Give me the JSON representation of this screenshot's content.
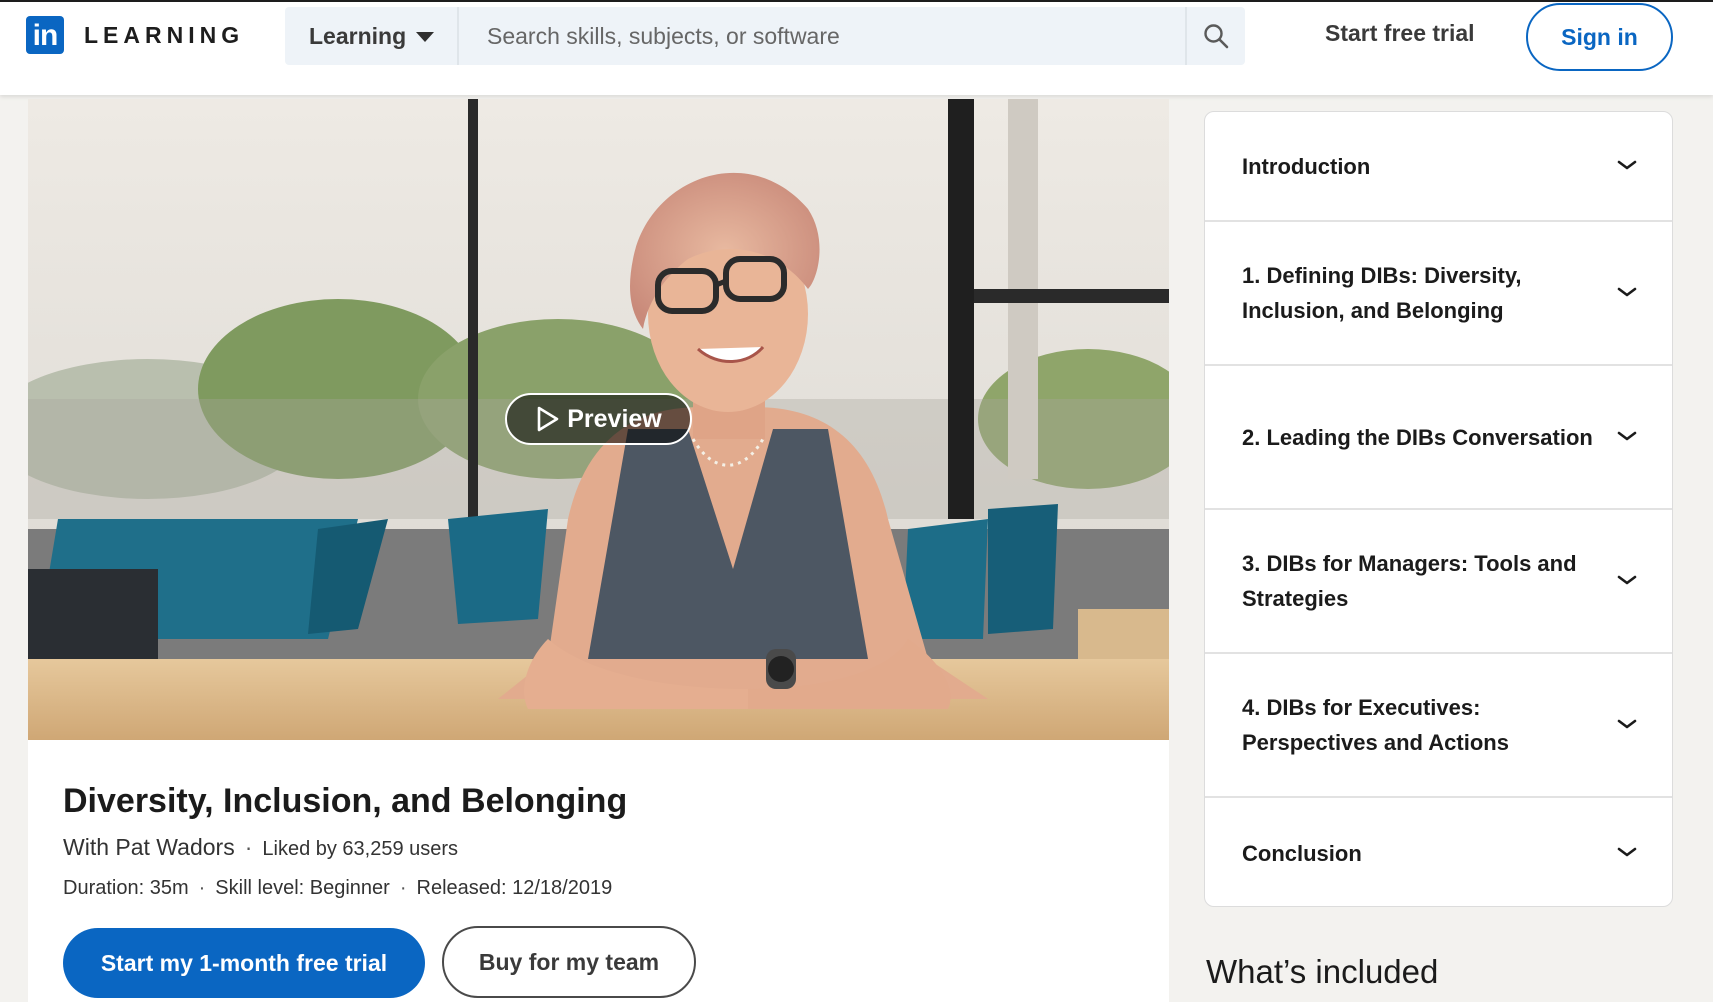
{
  "brand": {
    "logo_mark": "in",
    "logo_text": "LEARNING",
    "accent": "#0a66c2"
  },
  "header": {
    "category_label": "Learning",
    "search_placeholder": "Search skills, subjects, or software",
    "search_icon": "search-icon",
    "start_trial_label": "Start free trial",
    "sign_in_label": "Sign in"
  },
  "hero": {
    "preview_label": "Preview"
  },
  "course": {
    "title": "Diversity, Inclusion, and Belonging",
    "instructor": "With Pat Wadors",
    "likes": "Liked by 63,259 users",
    "duration": "Duration: 35m",
    "skill_level": "Skill level: Beginner",
    "released": "Released: 12/18/2019",
    "primary_cta": "Start my 1-month free trial",
    "secondary_cta": "Buy for my team"
  },
  "toc": {
    "items": [
      {
        "label": "Introduction"
      },
      {
        "label": "1. Defining DIBs: Diversity, Inclusion, and Belonging"
      },
      {
        "label": "2. Leading the DIBs Conversation"
      },
      {
        "label": "3. DIBs for Managers: Tools and Strategies"
      },
      {
        "label": "4. DIBs for Executives: Perspectives and Actions"
      },
      {
        "label": "Conclusion"
      }
    ]
  },
  "whats_included": "What’s included"
}
